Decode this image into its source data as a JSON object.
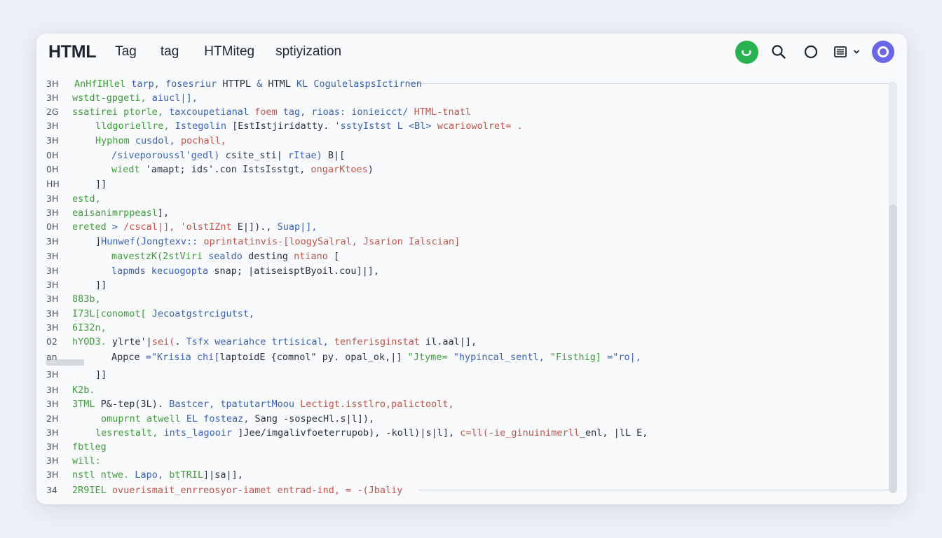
{
  "header": {
    "brand": "HTML",
    "tabs": [
      {
        "label": "Tag"
      },
      {
        "label": "tag"
      },
      {
        "label": "HTMiteg"
      },
      {
        "label": "sptiyization"
      }
    ],
    "status_color": "#27b24f",
    "profile_color": "#6b66e8"
  },
  "editor": {
    "lines": [
      {
        "num": "3H",
        "segments": [
          {
            "c": "g",
            "t": "AnHfIHlel "
          },
          {
            "c": "b",
            "t": "tarp, fosesriur "
          },
          {
            "c": "k",
            "t": "HTTPL "
          },
          {
            "c": "b",
            "t": "& "
          },
          {
            "c": "k",
            "t": "HTML "
          },
          {
            "c": "b",
            "t": "KL CogulelaspsIctirnen"
          }
        ]
      },
      {
        "num": "3H",
        "segments": [
          {
            "c": "g",
            "t": "wstdt-gpgeti, "
          },
          {
            "c": "b",
            "t": "aiucl|],"
          }
        ]
      },
      {
        "num": "2G",
        "segments": [
          {
            "c": "g",
            "t": "ssatirei ptorle, "
          },
          {
            "c": "b",
            "t": "taxcoupetianal "
          },
          {
            "c": "r",
            "t": "foem "
          },
          {
            "c": "b",
            "t": "tag, rioas: ionieicct/ "
          },
          {
            "c": "r",
            "t": "HTML-tnatl"
          }
        ]
      },
      {
        "num": "3H",
        "segments": [
          {
            "c": "g",
            "t": "lldgoriellre, "
          },
          {
            "c": "b",
            "t": "Istegolin "
          },
          {
            "c": "k",
            "t": "[EstIstjiridatty. "
          },
          {
            "c": "b",
            "t": "'sstyIstst L <Bl> "
          },
          {
            "c": "r",
            "t": "wcariowolret= ."
          }
        ]
      },
      {
        "num": "3H",
        "segments": [
          {
            "c": "g",
            "t": "Hyphom "
          },
          {
            "c": "b",
            "t": "cusdol, "
          },
          {
            "c": "r",
            "t": "pochall,"
          }
        ]
      },
      {
        "num": "0H",
        "segments": [
          {
            "c": "b",
            "t": "/siveporoussl'gedl) "
          },
          {
            "c": "k",
            "t": "csite_sti| "
          },
          {
            "c": "b",
            "t": "rItae) "
          },
          {
            "c": "k",
            "t": "B|["
          }
        ]
      },
      {
        "num": "0H",
        "segments": [
          {
            "c": "g",
            "t": "wiedt "
          },
          {
            "c": "k",
            "t": "'amapt; ids'.con IstsIsstgt, "
          },
          {
            "c": "r",
            "t": "ongarKtoes"
          },
          {
            "c": "k",
            "t": ")"
          }
        ]
      },
      {
        "num": "HH",
        "segments": [
          {
            "c": "k",
            "t": "]]"
          }
        ]
      },
      {
        "num": "3H",
        "segments": [
          {
            "c": "g",
            "t": "estd,"
          }
        ]
      },
      {
        "num": "3H",
        "segments": [
          {
            "c": "g",
            "t": "eaisanimrppeasl"
          },
          {
            "c": "k",
            "t": "],"
          }
        ]
      },
      {
        "num": "0H",
        "segments": [
          {
            "c": "g",
            "t": "ereted "
          },
          {
            "c": "b",
            "t": "> "
          },
          {
            "c": "r",
            "t": "/cscal|], "
          },
          {
            "c": "r",
            "t": "'olstIZnt "
          },
          {
            "c": "k",
            "t": "E|])., "
          },
          {
            "c": "b",
            "t": "Suap|],"
          }
        ]
      },
      {
        "num": "3H",
        "segments": [
          {
            "c": "k",
            "t": "]"
          },
          {
            "c": "b",
            "t": "Hunwef(Jongtexv:: "
          },
          {
            "c": "r",
            "t": "oprintatinvis-[loogySalral, "
          },
          {
            "c": "r",
            "t": "Jsarion Ialscian]"
          }
        ]
      },
      {
        "num": "3H",
        "segments": [
          {
            "c": "g",
            "t": "mavestzK(2stViri "
          },
          {
            "c": "b",
            "t": "sealdo "
          },
          {
            "c": "k",
            "t": "desting "
          },
          {
            "c": "r",
            "t": "ntiano"
          },
          {
            "c": "k",
            "t": " ["
          }
        ]
      },
      {
        "num": "3H",
        "segments": [
          {
            "c": "b",
            "t": "lapmds "
          },
          {
            "c": "b",
            "t": "kecuogopta "
          },
          {
            "c": "k",
            "t": "snap; |atiseisptByoil.cou]|],"
          }
        ]
      },
      {
        "num": "3H",
        "segments": [
          {
            "c": "k",
            "t": "]]"
          }
        ]
      },
      {
        "num": "3H",
        "segments": [
          {
            "c": "g",
            "t": "883b,"
          }
        ]
      },
      {
        "num": "3H",
        "segments": [
          {
            "c": "g",
            "t": "I73L[conomot[ "
          },
          {
            "c": "b",
            "t": "Jecoatgstrcigutst,"
          }
        ]
      },
      {
        "num": "3H",
        "segments": [
          {
            "c": "g",
            "t": "6I32n,"
          }
        ]
      },
      {
        "num": "02",
        "segments": [
          {
            "c": "g",
            "t": "hYOD3. "
          },
          {
            "c": "k",
            "t": "ylrte'|"
          },
          {
            "c": "r",
            "t": "sei("
          },
          {
            "c": "k",
            "t": ". "
          },
          {
            "c": "b",
            "t": "Tsfx "
          },
          {
            "c": "b",
            "t": "weariahce "
          },
          {
            "c": "b",
            "t": "trtisical, "
          },
          {
            "c": "r",
            "t": "tenferisginstat "
          },
          {
            "c": "k",
            "t": "il.aal|],"
          }
        ]
      },
      {
        "num": "an",
        "segments": [
          {
            "c": "k",
            "t": "Appce "
          },
          {
            "c": "b",
            "t": "=\"Krisia chi["
          },
          {
            "c": "k",
            "t": "laptoidE {comnol\" py. opal_ok,|] "
          },
          {
            "c": "g",
            "t": "\"Jtyme= "
          },
          {
            "c": "b",
            "t": "\"hypincal_sentl, "
          },
          {
            "c": "g",
            "t": "\"Fisthig] "
          },
          {
            "c": "b",
            "t": "=\"ro|,"
          }
        ]
      },
      {
        "num": "3H",
        "segments": [
          {
            "c": "k",
            "t": "]]"
          }
        ]
      },
      {
        "num": "3H",
        "segments": [
          {
            "c": "g",
            "t": "K2b."
          }
        ]
      },
      {
        "num": "3H",
        "segments": [
          {
            "c": "g",
            "t": "3TML "
          },
          {
            "c": "k",
            "t": "P&-tep(3L). "
          },
          {
            "c": "b",
            "t": "Bastcer, "
          },
          {
            "c": "b",
            "t": "tpatutartMoou "
          },
          {
            "c": "r",
            "t": "Lectigt.isstlro,palictoolt,"
          }
        ]
      },
      {
        "num": "2H",
        "segments": [
          {
            "c": "g",
            "t": "omuprnt atwell "
          },
          {
            "c": "b",
            "t": "EL fosteaz, "
          },
          {
            "c": "k",
            "t": "Sang -sospecHl.s|l]),"
          }
        ]
      },
      {
        "num": "3H",
        "segments": [
          {
            "c": "g",
            "t": "lesrestalt, "
          },
          {
            "c": "b",
            "t": "ints_lagooir "
          },
          {
            "c": "k",
            "t": "]Jee/imgalivfoeterrupob), "
          },
          {
            "c": "k",
            "t": "-koll)|s|l], "
          },
          {
            "c": "r",
            "t": "c=ll(-ie_ginuinimerll"
          },
          {
            "c": "k",
            "t": "_enl, |lL E,"
          }
        ]
      },
      {
        "num": "3H",
        "segments": [
          {
            "c": "g",
            "t": "fbtleg"
          }
        ]
      },
      {
        "num": "3H",
        "segments": [
          {
            "c": "g",
            "t": "will:"
          }
        ]
      },
      {
        "num": "3H",
        "segments": [
          {
            "c": "g",
            "t": "nstl ntwe. "
          },
          {
            "c": "b",
            "t": "Lapo, "
          },
          {
            "c": "g",
            "t": "btTRIL"
          },
          {
            "c": "k",
            "t": "]|sa|],"
          }
        ]
      },
      {
        "num": "34",
        "segments": [
          {
            "c": "g",
            "t": "2R9IEL "
          },
          {
            "c": "r",
            "t": "ovuerismait_enrreosyor-iamet "
          },
          {
            "c": "r",
            "t": "entrad-ind, "
          },
          {
            "c": "r",
            "t": "= -(Jbaliy"
          }
        ]
      }
    ]
  }
}
